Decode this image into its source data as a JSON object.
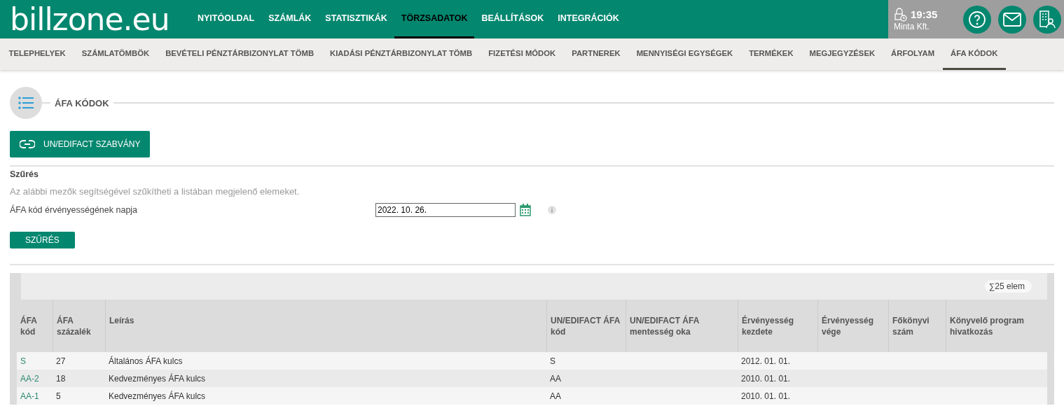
{
  "header": {
    "logo": "billzone.eu",
    "time": "19:35",
    "company": "Minta Kft.",
    "nav": [
      {
        "label": "NYITÓOLDAL",
        "selected": false
      },
      {
        "label": "SZÁMLÁK",
        "selected": false
      },
      {
        "label": "STATISZTIKÁK",
        "selected": false
      },
      {
        "label": "TÖRZSADATOK",
        "selected": true
      },
      {
        "label": "BEÁLLÍTÁSOK",
        "selected": false
      },
      {
        "label": "INTEGRÁCIÓK",
        "selected": false
      }
    ]
  },
  "subnav": [
    {
      "label": "TELEPHELYEK",
      "selected": false
    },
    {
      "label": "SZÁMLATÖMBÖK",
      "selected": false
    },
    {
      "label": "BEVÉTELI PÉNZTÁRBIZONYLAT TÖMB",
      "selected": false
    },
    {
      "label": "KIADÁSI PÉNZTÁRBIZONYLAT TÖMB",
      "selected": false
    },
    {
      "label": "FIZETÉSI MÓDOK",
      "selected": false
    },
    {
      "label": "PARTNEREK",
      "selected": false
    },
    {
      "label": "MENNYISÉGI EGYSÉGEK",
      "selected": false
    },
    {
      "label": "TERMÉKEK",
      "selected": false
    },
    {
      "label": "MEGJEGYZÉSEK",
      "selected": false
    },
    {
      "label": "ÁRFOLYAM",
      "selected": false
    },
    {
      "label": "ÁFA KÓDOK",
      "selected": true
    }
  ],
  "section_title": "ÁFA KÓDOK",
  "link_button": "UN/EDIFACT SZABVÁNY",
  "filter": {
    "title": "Szűrés",
    "description": "Az alábbi mezők segítségével szűkítheti a listában megjelenő elemeket.",
    "field_label": "ÁFA kód érvényességének napja",
    "field_value": "2022. 10. 26.",
    "button": "SZŰRÉS"
  },
  "table": {
    "count": "∑25 elem",
    "columns": [
      "ÁFA kód",
      "ÁFA százalék",
      "Leírás",
      "UN/EDIFACT ÁFA kód",
      "UN/EDIFACT ÁFA mentesség oka",
      "Érvényesség kezdete",
      "Érvényesség vége",
      "Főkönyvi szám",
      "Könyvelő program hivatkozás"
    ],
    "rows": [
      [
        "S",
        "27",
        "Általános ÁFA kulcs",
        "S",
        "",
        "2012. 01. 01.",
        "",
        "",
        ""
      ],
      [
        "AA-2",
        "18",
        "Kedvezményes ÁFA kulcs",
        "AA",
        "",
        "2010. 01. 01.",
        "",
        "",
        ""
      ],
      [
        "AA-1",
        "5",
        "Kedvezményes ÁFA kulcs",
        "AA",
        "",
        "2010. 01. 01.",
        "",
        "",
        ""
      ]
    ]
  }
}
